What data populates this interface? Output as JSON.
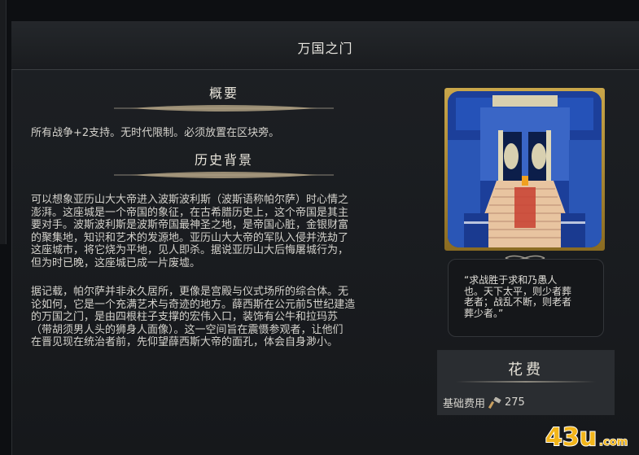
{
  "window": {
    "title": "万国之门"
  },
  "summary": {
    "heading": "概要",
    "text": "所有战争+2支持。无时代限制。必须放置在区块旁。"
  },
  "history": {
    "heading": "历史背景",
    "paragraph1_lines": [
      "可以想象亚历山大大帝进入波斯波利斯（波斯语称帕尔萨）时心情之",
      "澎湃。这座城是一个帝国的象征，在古希腊历史上，这个帝国是其主",
      "要对手。波斯波利斯是波斯帝国最神圣之地，是帝国心脏，金银财富",
      "的聚集地，知识和艺术的发源地。亚历山大大帝的军队入侵并洗劫了",
      "这座城市，将它烧为平地，见人即杀。据说亚历山大后悔屠城行为，",
      "但为时已晚，这座城已成一片废墟。"
    ],
    "paragraph2_lines": [
      "据记载，帕尔萨并非永久居所，更像是宫殿与仪式场所的综合体。无",
      "论如何，它是一个充满艺术与奇迹的地方。薛西斯在公元前5世纪建造",
      "的万国之门，是由四根柱子支撑的宏伟入口，装饰有公牛和拉玛苏",
      "（带胡须男人头的狮身人面像）。这一空间旨在震慑参观者，让他们",
      "在晋见现在统治者前，先仰望薛西斯大帝的面孔，体会自身渺小。"
    ]
  },
  "quote": {
    "lines": [
      "“求战胜于求和乃愚人",
      "也。天下太平，则少者葬",
      "老者；战乱不断，则老者",
      "葬少者。”"
    ]
  },
  "cost": {
    "heading": "花费",
    "label": "基础费用",
    "icon": "hammer-icon",
    "value": "275"
  },
  "watermark": {
    "text": "43u",
    "suffix": ".com"
  },
  "colors": {
    "gold": "#c9a64a",
    "panel": "#2a2d31",
    "background": "#1a1c1f"
  }
}
